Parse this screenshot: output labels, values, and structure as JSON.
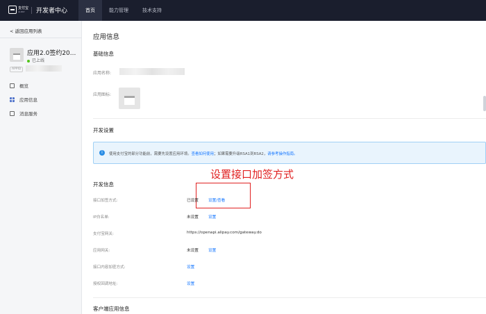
{
  "header": {
    "logo_text": "支付宝",
    "logo_sub": "ALIPAY",
    "title": "开发者中心",
    "nav": [
      {
        "label": "首页",
        "active": true
      },
      {
        "label": "能力管理",
        "active": false
      },
      {
        "label": "技术支持",
        "active": false
      }
    ]
  },
  "sidebar": {
    "back_label": "< 返回应用列表",
    "app_name": "应用2.0签约20...",
    "app_status": "已上线",
    "appid_tag": "APPID",
    "menu": [
      {
        "label": "概览",
        "icon": "monitor-icon"
      },
      {
        "label": "应用信息",
        "icon": "grid-icon"
      },
      {
        "label": "消息服务",
        "icon": "message-icon"
      }
    ]
  },
  "main": {
    "page_title": "应用信息",
    "basic": {
      "title": "基础信息",
      "name_label": "应用名称:",
      "icon_label": "应用图标:"
    },
    "dev_settings": {
      "title": "开发设置",
      "notice_prefix": "使用支付宝的部分功能前，需要先设置应用环境。",
      "notice_link1": "查看如何使用",
      "notice_middle": "；如果需要升级RSA1到RSA2，",
      "notice_link2": "请参考操作指南。"
    },
    "annotation": "设置接口加签方式",
    "dev_info": {
      "title": "开发信息",
      "rows": [
        {
          "label": "接口加签方式:",
          "value": "已设置",
          "link": "设置/查看"
        },
        {
          "label": "IP白名单:",
          "value": "未设置",
          "link": "设置"
        },
        {
          "label": "支付宝网关:",
          "value": "https://openapi.alipay.com/gateway.do",
          "link": ""
        },
        {
          "label": "应用网关:",
          "value": "未设置",
          "link": "设置"
        },
        {
          "label": "接口内容加密方式:",
          "value": "",
          "link": "设置"
        },
        {
          "label": "授权回调地址:",
          "value": "",
          "link": "设置"
        }
      ]
    },
    "client_section_title": "客户端应用信息"
  }
}
